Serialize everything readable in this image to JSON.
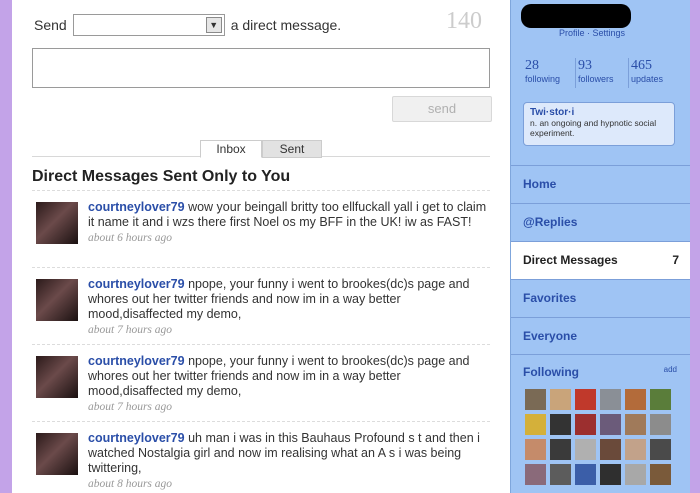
{
  "compose": {
    "send_label": "Send",
    "suffix": "a direct message.",
    "char_count": "140",
    "send_button": "send"
  },
  "tabs": [
    "Inbox",
    "Sent"
  ],
  "heading": "Direct Messages Sent Only to You",
  "messages": [
    {
      "user": "courtneylover79",
      "text": "wow your beingall britty too ellfuckall yall i get to claim it name it and i wzs there first Noel os my BFF in the UK! iw as FAST!",
      "time": "about 6 hours ago"
    },
    {
      "user": "courtneylover79",
      "text": "npope, your funny i went to brookes(dc)s page and whores out her twitter friends and now im in a way better mood,disaffected my demo,",
      "time": "about 7 hours ago"
    },
    {
      "user": "courtneylover79",
      "text": "npope, your funny i went to brookes(dc)s page and whores out her twitter friends and now im in a way better mood,disaffected my demo,",
      "time": "about 7 hours ago"
    },
    {
      "user": "courtneylover79",
      "text": "uh man i was in this Bauhaus Profound s  t and then i watched Nostalgia girl and now im realising what an A  s i was being twittering,",
      "time": "about 8 hours ago"
    }
  ],
  "sidebar": {
    "profile_links": "Profile · Settings",
    "stats": [
      {
        "n": "28",
        "label": "following"
      },
      {
        "n": "93",
        "label": "followers"
      },
      {
        "n": "465",
        "label": "updates"
      }
    ],
    "twistori_title": "Twi·stor·i",
    "twistori_desc": "n. an ongoing and hypnotic social experiment.",
    "nav": [
      {
        "label": "Home",
        "count": ""
      },
      {
        "label": "@Replies",
        "count": ""
      },
      {
        "label": "Direct Messages",
        "count": "7"
      },
      {
        "label": "Favorites",
        "count": ""
      },
      {
        "label": "Everyone",
        "count": ""
      }
    ],
    "following_label": "Following",
    "add_label": "add",
    "thumb_colors": [
      "#7a6a55",
      "#c9a47a",
      "#c0392b",
      "#8a8f96",
      "#b36b3a",
      "#5a7d3a",
      "#d4b03a",
      "#333333",
      "#9c2f2f",
      "#6b5b7a",
      "#a07a5a",
      "#8c8c8c",
      "#c58b6a",
      "#3a3a3a",
      "#b0b0b0",
      "#6a4a3a",
      "#c2a28a",
      "#4a4a4a",
      "#8a6a7a",
      "#5c5c5c",
      "#3b5ea8",
      "#2f2f2f",
      "#a8a8a8",
      "#7a5a3a"
    ]
  }
}
